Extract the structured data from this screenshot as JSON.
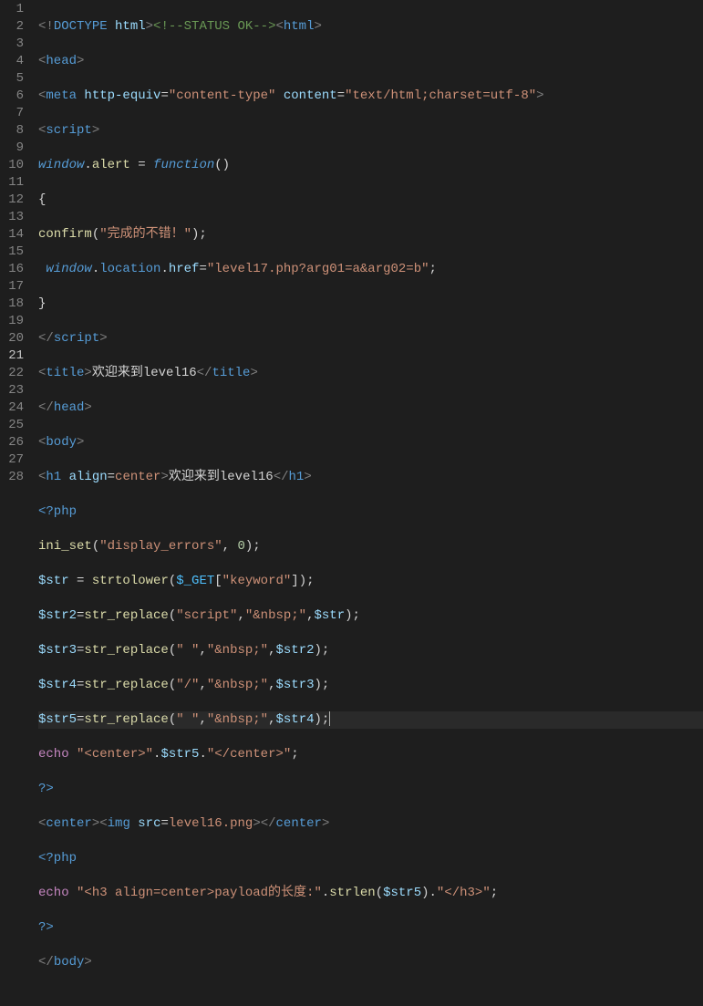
{
  "editor": {
    "line_count": 28,
    "active_line": 21
  },
  "lines": {
    "l1": {
      "a": "<!",
      "b": "DOCTYPE",
      "c": " html",
      "d": ">",
      "e": "<!--STATUS OK-->",
      "f": "<",
      "g": "html",
      "h": ">"
    },
    "l2": {
      "a": "<",
      "b": "head",
      "c": ">"
    },
    "l3": {
      "a": "<",
      "b": "meta",
      "c": " ",
      "d": "http-equiv",
      "e": "=",
      "f": "\"content-type\"",
      "g": " ",
      "h": "content",
      "i": "=",
      "j": "\"text/html;charset=utf-8\"",
      "k": ">"
    },
    "l4": {
      "a": "<",
      "b": "script",
      "c": ">"
    },
    "l5": {
      "a": "window",
      "b": ".",
      "c": "alert",
      "d": " = ",
      "e": "function",
      "f": "()"
    },
    "l6": {
      "a": "{"
    },
    "l7": {
      "a": "confirm",
      "b": "(",
      "c": "\"完成的不错！\"",
      "d": ");"
    },
    "l8": {
      "a": " window",
      "b": ".",
      "c": "location",
      "d": ".",
      "e": "href",
      "f": "=",
      "g": "\"level17.php?arg01=a&arg02=b\"",
      "h": ";"
    },
    "l9": {
      "a": "}"
    },
    "l10": {
      "a": "</",
      "b": "script",
      "c": ">"
    },
    "l11": {
      "a": "<",
      "b": "title",
      "c": ">",
      "d": "欢迎来到level16",
      "e": "</",
      "f": "title",
      "g": ">"
    },
    "l12": {
      "a": "</",
      "b": "head",
      "c": ">"
    },
    "l13": {
      "a": "<",
      "b": "body",
      "c": ">"
    },
    "l14": {
      "a": "<",
      "b": "h1",
      "c": " ",
      "d": "align",
      "e": "=",
      "f": "center",
      "g": ">",
      "h": "欢迎来到level16",
      "i": "</",
      "j": "h1",
      "k": ">"
    },
    "l15": {
      "a": "<?php"
    },
    "l16": {
      "a": "ini_set",
      "b": "(",
      "c": "\"display_errors\"",
      "d": ", ",
      "e": "0",
      "f": ");"
    },
    "l17": {
      "a": "$str",
      "b": " = ",
      "c": "strtolower",
      "d": "(",
      "e": "$_GET",
      "f": "[",
      "g": "\"keyword\"",
      "h": "]);"
    },
    "l18": {
      "a": "$str2",
      "b": "=",
      "c": "str_replace",
      "d": "(",
      "e": "\"script\"",
      "f": ",",
      "g": "\"&nbsp;\"",
      "h": ",",
      "i": "$str",
      "j": ");"
    },
    "l19": {
      "a": "$str3",
      "b": "=",
      "c": "str_replace",
      "d": "(",
      "e": "\" \"",
      "f": ",",
      "g": "\"&nbsp;\"",
      "h": ",",
      "i": "$str2",
      "j": ");"
    },
    "l20": {
      "a": "$str4",
      "b": "=",
      "c": "str_replace",
      "d": "(",
      "e": "\"/\"",
      "f": ",",
      "g": "\"&nbsp;\"",
      "h": ",",
      "i": "$str3",
      "j": ");"
    },
    "l21": {
      "a": "$str5",
      "b": "=",
      "c": "str_replace",
      "d": "(",
      "e": "\" \"",
      "f": ",",
      "g": "\"&nbsp;\"",
      "h": ",",
      "i": "$str4",
      "j": ");"
    },
    "l22": {
      "a": "echo",
      "b": " ",
      "c": "\"<center>\"",
      "d": ".",
      "e": "$str5",
      "f": ".",
      "g": "\"</center>\"",
      "h": ";"
    },
    "l23": {
      "a": "?>"
    },
    "l24": {
      "a": "<",
      "b": "center",
      "c": "><",
      "d": "img",
      "e": " ",
      "f": "src",
      "g": "=",
      "h": "level16.png",
      "i": "></",
      "j": "center",
      "k": ">"
    },
    "l25": {
      "a": "<?php"
    },
    "l26": {
      "a": "echo",
      "b": " ",
      "c": "\"<h3 align=center>payload的长度:\"",
      "d": ".",
      "e": "strlen",
      "f": "(",
      "g": "$str5",
      "h": ").",
      "i": "\"</h3>\"",
      "j": ";"
    },
    "l27": {
      "a": "?>"
    },
    "l28": {
      "a": "</",
      "b": "body",
      "c": ">"
    }
  }
}
